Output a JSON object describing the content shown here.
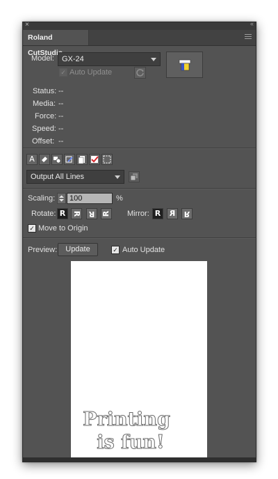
{
  "window": {
    "close_glyph": "×",
    "collapse_glyph": "‹‹"
  },
  "tab": {
    "title": "Roland CutStudio"
  },
  "model": {
    "label": "Model:",
    "value": "GX-24",
    "auto_update_label": "Auto Update",
    "auto_update_checked": true,
    "auto_update_enabled": false
  },
  "status": {
    "rows": [
      {
        "label": "Status:",
        "value": "--"
      },
      {
        "label": "Media:",
        "value": "--"
      },
      {
        "label": "Force:",
        "value": "--"
      },
      {
        "label": "Speed:",
        "value": "--"
      },
      {
        "label": "Offset:",
        "value": "--"
      }
    ]
  },
  "tools": {
    "icons": [
      "text-tool-icon",
      "fill-tool-icon",
      "shapes-tool-icon",
      "pen-tool-icon",
      "page-tool-icon",
      "check-tool-icon",
      "marquee-tool-icon"
    ],
    "text_glyph": "A"
  },
  "output": {
    "selected": "Output All Lines"
  },
  "scaling": {
    "label": "Scaling:",
    "value": "100",
    "unit": "%"
  },
  "rotate": {
    "label": "Rotate:",
    "glyphs": [
      "R",
      "R",
      "R",
      "R"
    ]
  },
  "mirror": {
    "label": "Mirror:",
    "glyphs": [
      "R",
      "R",
      "R"
    ]
  },
  "move_to_origin": {
    "label": "Move to Origin",
    "checked": true
  },
  "preview": {
    "label": "Preview:",
    "update_button": "Update",
    "auto_update_label": "Auto Update",
    "auto_update_checked": true,
    "text_line1": "Printing",
    "text_line2": "is fun!"
  },
  "colors": {
    "panel_bg": "#535353",
    "accent_red": "#d9262b",
    "cutter_icon_yellow": "#f2d22e"
  }
}
